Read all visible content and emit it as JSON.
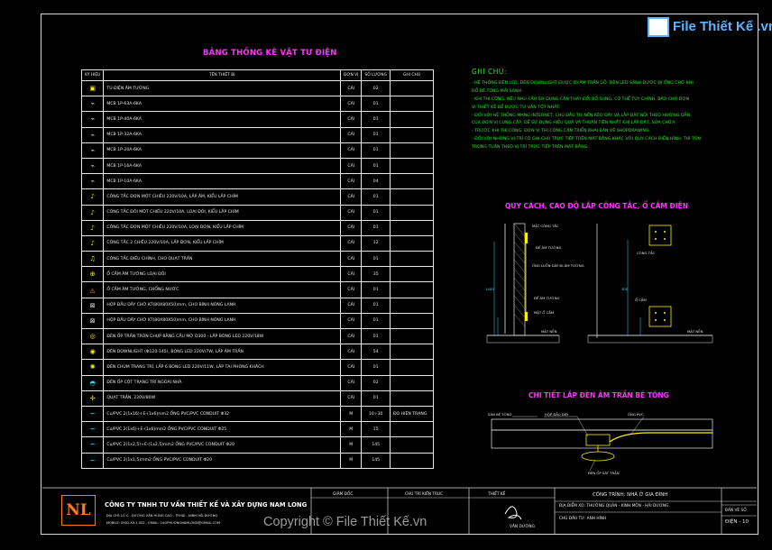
{
  "header": {
    "title": "BẢNG THỐNG KÊ VẬT TƯ ĐIỆN"
  },
  "table": {
    "columns": [
      "KÝ HIỆU",
      "TÊN THIẾT BỊ",
      "ĐƠN VỊ",
      "SỐ LƯỢNG",
      "GHI CHÚ"
    ],
    "rows": [
      {
        "icon": "panel-icon",
        "cls": "",
        "name": "TỦ ĐIỆN ÂM TƯỜNG",
        "unit": "CÁI",
        "qty": "02",
        "note": ""
      },
      {
        "icon": "breaker-icon",
        "cls": "g",
        "name": "MCB 1P-63A-6KA",
        "unit": "CÁI",
        "qty": "01",
        "note": ""
      },
      {
        "icon": "breaker-icon",
        "cls": "g",
        "name": "MCB 1P-40A-6KA",
        "unit": "CÁI",
        "qty": "01",
        "note": ""
      },
      {
        "icon": "breaker-icon",
        "cls": "g",
        "name": "MCB 1P-32A-6KA",
        "unit": "CÁI",
        "qty": "01",
        "note": ""
      },
      {
        "icon": "breaker-icon",
        "cls": "g",
        "name": "MCB 1P-20A-6KA",
        "unit": "CÁI",
        "qty": "01",
        "note": ""
      },
      {
        "icon": "breaker-icon",
        "cls": "g",
        "name": "MCB 1P-16A-6KA",
        "unit": "CÁI",
        "qty": "01",
        "note": ""
      },
      {
        "icon": "breaker-icon",
        "cls": "g",
        "name": "MCB 1P-10A-6KA",
        "unit": "CÁI",
        "qty": "04",
        "note": ""
      },
      {
        "icon": "switch-icon",
        "cls": "",
        "name": "CÔNG TẮC ĐƠN MỘT CHIỀU 220V/10A, LẮP ÂM, KIỂU LẮP CHÌM",
        "unit": "CÁI",
        "qty": "01",
        "note": ""
      },
      {
        "icon": "switch-icon",
        "cls": "",
        "name": "CÔNG TẮC ĐÔI MỘT CHIỀU 220V/10A, LOẠI ĐÔI, KIỂU LẮP CHÌM",
        "unit": "CÁI",
        "qty": "01",
        "note": ""
      },
      {
        "icon": "switch-icon",
        "cls": "",
        "name": "CÔNG TẮC ĐƠN MỘT CHIỀU 220V/10A, LOẠI ĐƠN, KIỂU LẮP CHÌM",
        "unit": "CÁI",
        "qty": "01",
        "note": ""
      },
      {
        "icon": "switch-icon",
        "cls": "",
        "name": "CÔNG TẮC 2 CHIỀU 220V/10A, LẮP ĐƠN, KIỂU LẮP CHÌM",
        "unit": "CÁI",
        "qty": "12",
        "note": ""
      },
      {
        "icon": "fan-switch-icon",
        "cls": "",
        "name": "CÔNG TẮC ĐIỀU CHỈNH, CHO QUẠT TRẦN",
        "unit": "CÁI",
        "qty": "01",
        "note": ""
      },
      {
        "icon": "socket-icon",
        "cls": "",
        "name": "Ổ CẮM ÂM TƯỜNG LOẠI ĐÔI",
        "unit": "CÁI",
        "qty": "35",
        "note": ""
      },
      {
        "icon": "waterproof-socket-icon",
        "cls": "o",
        "name": "Ổ CẮM ÂM TƯỜNG, CHỐNG NƯỚC",
        "unit": "CÁI",
        "qty": "01",
        "note": ""
      },
      {
        "icon": "junction-box-icon",
        "cls": "g",
        "name": "HỘP ĐẦU DÂY CHỜ KT(80X80X50)mm, CHO BÌNH NÓNG LẠNH",
        "unit": "CÁI",
        "qty": "01",
        "note": ""
      },
      {
        "icon": "junction-box-icon",
        "cls": "g",
        "name": "HỘP ĐẦU DÂY CHỜ KT(80X80X50)mm, CHO BÌNH NÓNG LẠNH",
        "unit": "CÁI",
        "qty": "01",
        "note": ""
      },
      {
        "icon": "ceiling-light-icon",
        "cls": "",
        "name": "ĐÈN ỐP TRẦN TRÒN CHỤP BẰNG CẦU MỜ D300 - LẮP BÓNG LED 220V/18W",
        "unit": "CÁI",
        "qty": "01",
        "note": ""
      },
      {
        "icon": "downlight-icon",
        "cls": "",
        "name": "ĐÈN DOWNLIGHT (Φ120-145), BÓNG LED 220V/7W, LẮP ÂM TRẦN",
        "unit": "CÁI",
        "qty": "54",
        "note": ""
      },
      {
        "icon": "chandelier-icon",
        "cls": "",
        "name": "ĐÈN CHÙM TRANG TRÍ, LẮP 6 BÓNG LED 220V/11W, LẮP TẠI PHÒNG KHÁCH",
        "unit": "CÁI",
        "qty": "01",
        "note": ""
      },
      {
        "icon": "wall-light-icon",
        "cls": "c",
        "name": "ĐÈN ỐP CỘT TRANG TRÍ NGOÀI NHÀ",
        "unit": "CÁI",
        "qty": "02",
        "note": ""
      },
      {
        "icon": "ceiling-fan-icon",
        "cls": "",
        "name": "QUẠT TRẦN, 220V/80W",
        "unit": "CÁI",
        "qty": "01",
        "note": ""
      },
      {
        "icon": "conduit-line-icon",
        "cls": "c",
        "name": "Cu/PVC 2(1x16)+E-(1x6)mm2 ỐNG PVC/PVC CONDUIT Φ32",
        "unit": "M",
        "qty": "10÷30",
        "note": "ĐO HIỆN TRẠNG"
      },
      {
        "icon": "conduit-line-icon",
        "cls": "c",
        "name": "Cu/PVC 2(1x6)+E-(1x6)mm2 ỐNG PVC/PVC CONDUIT Φ25",
        "unit": "M",
        "qty": "15",
        "note": ""
      },
      {
        "icon": "conduit-line-icon",
        "cls": "c",
        "name": "Cu/PVC 2(1x2,5)+E-(1x2,5)mm2 ỐNG PVC/PVC CONDUIT Φ20",
        "unit": "M",
        "qty": "145",
        "note": ""
      },
      {
        "icon": "conduit-line-icon",
        "cls": "c",
        "name": "Cu/PVC 2(1x1,5)mm2 ỐNG PVC/PVC CONDUIT Φ20",
        "unit": "M",
        "qty": "145",
        "note": ""
      }
    ]
  },
  "notes": {
    "heading": "GHI CHÚ:",
    "lines": [
      "- HỆ THỐNG ĐÈN LED, ĐÈN DOWNLIGHT ĐƯỢC ĐI ÂM TRẦN GỖ. ĐÈN LED SẢNH ĐƯỢC ĐI ỐNG CHỜ KHI",
      "ĐỔ BÊ TÔNG MÁI SẢNH.",
      "- KHI THI CÔNG, NẾU NHU CẦU SỬ DỤNG CẦN THAY ĐỔI BỔ SUNG, CÓ THỂ TÙY CHỈNH, BÁO CHO ĐƠN",
      "VỊ THIẾT KẾ ĐỂ ĐƯỢC TƯ VẤN TỐT NHẤT.",
      "- ĐỐI VỚI HỆ THỐNG MẠNG INTERNET, CHỦ ĐẦU TƯ NÊN KÉO DÂY VÀ LẮP ĐẶT NỐI THEO HƯỚNG DẪN",
      "CỦA ĐƠN VỊ CUNG CẤP, ĐỂ SỬ DỤNG HIỆU QUẢ VÀ THUẬN TIỆN NHẤT KHI LẮP ĐẶT, SỬA CHỮA.",
      "- TRƯỚC KHI THI CÔNG, ĐƠN VỊ THI CÔNG CẦN TRIỂN KHAI BẢN VẼ SHOPDRAWING.",
      "- ĐỐI VỚI NHỮNG VỊ TRÍ CÓ GHI CHÚ TRỰC TIẾP TRÊN MẶT BẰNG KHÁC VỚI QUY CÁCH ĐIỂN HÌNH, THÌ TÔN",
      "TRỌNG TUÂN THEO VỊ TRÍ TRỰC TIẾP TRÊN MẶT BẰNG."
    ]
  },
  "detail1": {
    "title": "QUY CÁCH, CAO ĐỘ LẮP CÔNG TẮC, Ổ CẮM ĐIỆN",
    "labels": {
      "switch_face": "MẶT CÔNG TẮC",
      "wall_box": "ĐẾ ÂM TƯỜNG",
      "conduit": "ỐNG LUỒN DÂY ĐI ÂM TƯỜNG",
      "socket_box": "ĐẾ ÂM TƯỜNG",
      "socket_face": "MẶT Ổ CẮM",
      "floor": "MẶT NỀN",
      "switch": "CÔNG TẮC",
      "socket": "Ổ CẮM",
      "floor2": "MẶT NỀN",
      "h1": "1400",
      "h2": "300"
    }
  },
  "detail2": {
    "title": "CHI TIẾT LẮP ĐÈN ÂM TRẦN BÊ TÔNG",
    "labels": {
      "slab": "SÀN BÊ TÔNG",
      "box": "HỘP ĐẦU DÂY",
      "pipe": "ỐNG PVC",
      "lamp": "ĐÈN ỐP SÁT TRẦN"
    }
  },
  "titleblock": {
    "logo": "NL",
    "company": "CÔNG TY TNHH TƯ VẤN THIẾT KẾ VÀ XÂY DỰNG NAM LONG",
    "address1": "ĐỊA CHỈ: LÔ C - ĐƯỜNG VĂN HƯNG CAO - TP.HẢI - NINH HẢI DƯƠNG",
    "address2": "MOBILE: 0902.XX.1.002 - EMAIL: CAOPHUONGNAMLONG@GMAIL.COM",
    "director": "GIÁM ĐỐC",
    "chief": "CHỦ TRÌ KIẾN TRÚC",
    "designer": "THIẾT KẾ",
    "designer_name": "VĂN DƯƠNG",
    "project": "CÔNG TRÌNH: NHÀ Ở GIA ĐÌNH",
    "location": "ĐỊA ĐIỂM XD: THƯỜNG QUẢN - KINH MÔN - HẢI DƯƠNG",
    "owner": "CHỦ ĐẦU TƯ: ANH HÌNH",
    "sheet_label": "BẢN VẼ SỐ",
    "sheet_no": "ĐIỆN - 10"
  },
  "watermark": {
    "text": "Copyright © File Thiết Kế.vn",
    "brand": "File Thiết Kế .vn"
  },
  "colors": {
    "title": "#ff33ff",
    "notes": "#2fe82f",
    "cyan": "#2de0ff",
    "yellow": "#ffee00",
    "logo": "#ff7a1a"
  }
}
